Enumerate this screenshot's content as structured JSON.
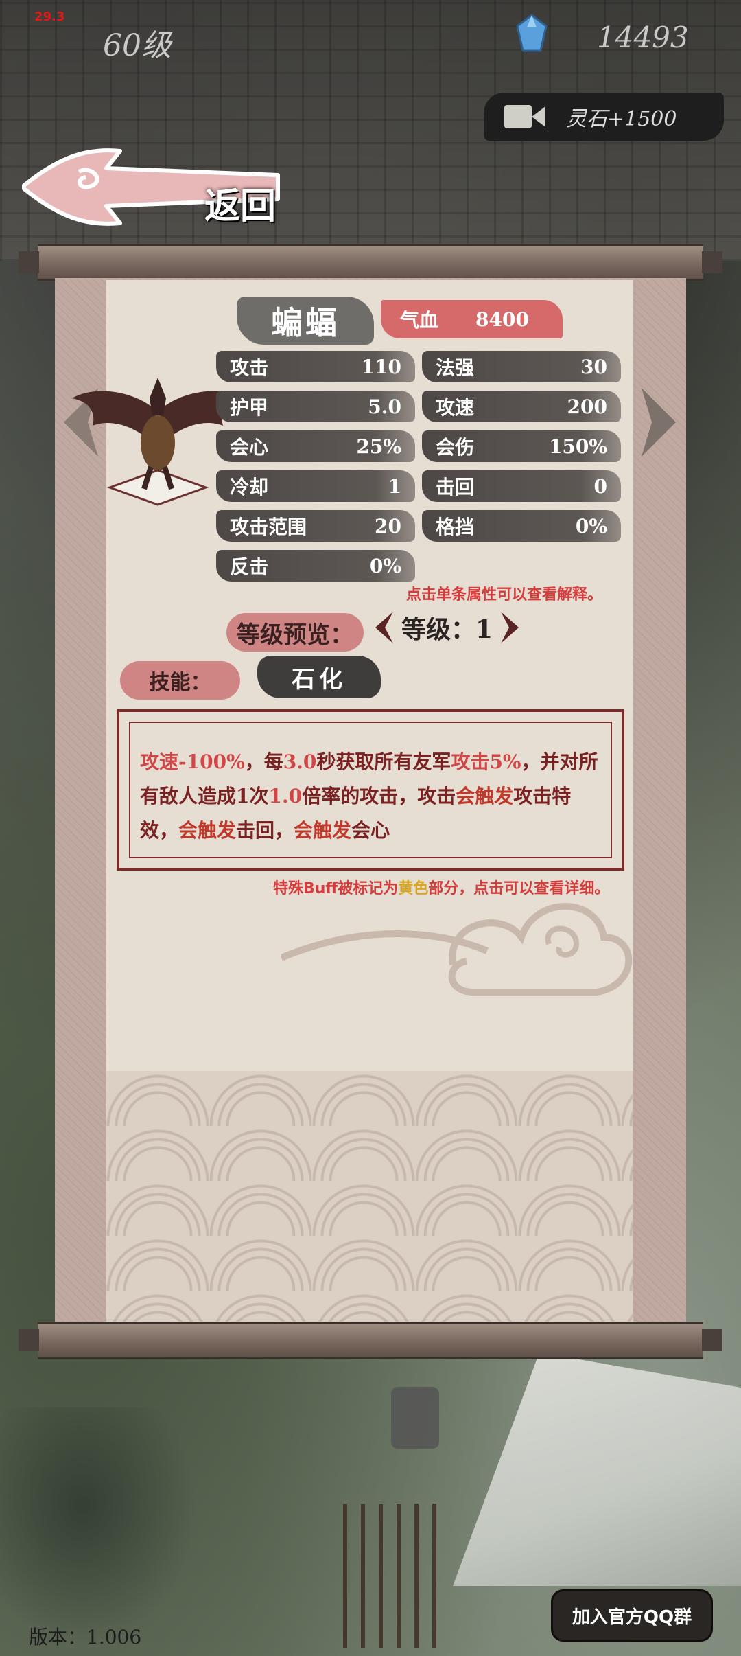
{
  "hud": {
    "debug_text": "29.3",
    "level": "60级",
    "gems": "14493",
    "video_reward": "灵石+1500"
  },
  "nav": {
    "back_label": "返回"
  },
  "monster": {
    "name": "蝙蝠",
    "hp_label": "气血",
    "hp_value": "8400",
    "stats": [
      {
        "label": "攻击",
        "value": "110"
      },
      {
        "label": "法强",
        "value": "30"
      },
      {
        "label": "护甲",
        "value": "5.0"
      },
      {
        "label": "攻速",
        "value": "200"
      },
      {
        "label": "会心",
        "value": "25%"
      },
      {
        "label": "会伤",
        "value": "150%"
      },
      {
        "label": "冷却",
        "value": "1"
      },
      {
        "label": "击回",
        "value": "0"
      },
      {
        "label": "攻击范围",
        "value": "20"
      },
      {
        "label": "格挡",
        "value": "0%"
      },
      {
        "label": "反击",
        "value": "0%"
      }
    ],
    "stat_hint": "点击单条属性可以查看解释。"
  },
  "level_preview": {
    "label": "等级预览：",
    "value": "等级：1"
  },
  "skill": {
    "label": "技能：",
    "name": "石化",
    "description_parts": [
      {
        "text": "攻速-100%",
        "style": "hl"
      },
      {
        "text": "，每",
        "style": ""
      },
      {
        "text": "3.0",
        "style": "hl"
      },
      {
        "text": "秒获取所有友军",
        "style": ""
      },
      {
        "text": "攻击5%",
        "style": "hl"
      },
      {
        "text": "，并对所有敌人造成1次",
        "style": ""
      },
      {
        "text": "1.0",
        "style": "hl"
      },
      {
        "text": "倍率的攻击，攻击",
        "style": ""
      },
      {
        "text": "会触发",
        "style": "hl2"
      },
      {
        "text": "攻击特效，",
        "style": ""
      },
      {
        "text": "会触发",
        "style": "hl2"
      },
      {
        "text": "击回，",
        "style": ""
      },
      {
        "text": "会触发",
        "style": "hl2"
      },
      {
        "text": "会心",
        "style": ""
      }
    ],
    "buff_hint_pre": "特殊Buff被标记为",
    "buff_hint_yellow": "黄色",
    "buff_hint_post": "部分，点击可以查看详细。"
  },
  "footer": {
    "version": "版本：1.006",
    "qq_button": "加入官方QQ群"
  },
  "colors": {
    "accent_red": "#d63c3c",
    "text_dark_red": "#7a2222",
    "paper": "#e6ddd3",
    "stat_bg": "#4d4846",
    "hp_bg": "#d66a6a",
    "gem_blue": "#5aa0dc"
  },
  "icons": [
    "gem-icon",
    "video-camera-icon",
    "back-arrow-icon",
    "left-arrow-icon",
    "right-arrow-icon",
    "chevron-left-icon",
    "chevron-right-icon",
    "cloud-ornament"
  ]
}
